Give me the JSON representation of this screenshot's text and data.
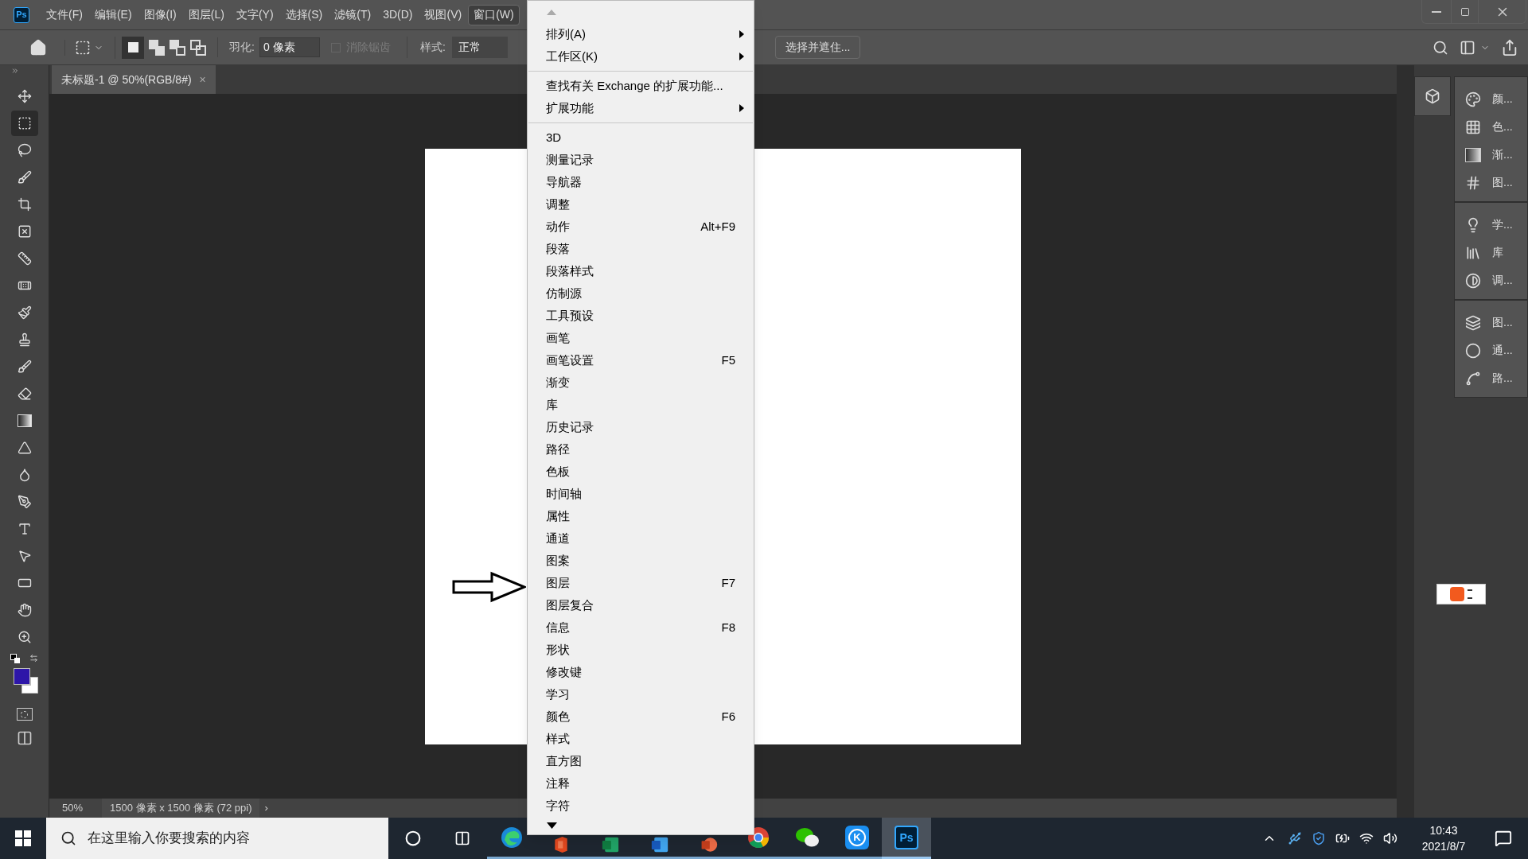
{
  "app": {
    "logo": "Ps"
  },
  "menubar": [
    {
      "label": "文件(F)",
      "selected": false
    },
    {
      "label": "编辑(E)",
      "selected": false
    },
    {
      "label": "图像(I)",
      "selected": false
    },
    {
      "label": "图层(L)",
      "selected": false
    },
    {
      "label": "文字(Y)",
      "selected": false
    },
    {
      "label": "选择(S)",
      "selected": false
    },
    {
      "label": "滤镜(T)",
      "selected": false
    },
    {
      "label": "3D(D)",
      "selected": false
    },
    {
      "label": "视图(V)",
      "selected": false
    },
    {
      "label": "窗口(W)",
      "selected": true
    }
  ],
  "options_bar": {
    "feather_label": "羽化:",
    "feather_value": "0 像素",
    "anti_alias": {
      "label": "消除锯齿",
      "checked": false,
      "disabled": true
    },
    "style_label": "样式:",
    "style_value": "正常",
    "select_mask_button": "选择并遮住..."
  },
  "document_tab": {
    "title": "未标题-1 @ 50%(RGB/8#)",
    "close": "×"
  },
  "tools": [
    {
      "kind": "move",
      "selected": false
    },
    {
      "kind": "marquee",
      "selected": true
    },
    {
      "kind": "lasso",
      "selected": false
    },
    {
      "kind": "quick-select",
      "selected": false
    },
    {
      "kind": "crop",
      "selected": false
    },
    {
      "kind": "frame",
      "selected": false
    },
    {
      "kind": "ruler",
      "selected": false
    },
    {
      "kind": "healing",
      "selected": false
    },
    {
      "kind": "brush",
      "selected": false
    },
    {
      "kind": "stamp",
      "selected": false
    },
    {
      "kind": "history-brush",
      "selected": false
    },
    {
      "kind": "eraser",
      "selected": false
    },
    {
      "kind": "gradient",
      "selected": false
    },
    {
      "kind": "blur",
      "selected": false
    },
    {
      "kind": "dodge",
      "selected": false
    },
    {
      "kind": "pen",
      "selected": false
    },
    {
      "kind": "type",
      "selected": false
    },
    {
      "kind": "path-select",
      "selected": false
    },
    {
      "kind": "rectangle",
      "selected": false
    },
    {
      "kind": "hand",
      "selected": false
    },
    {
      "kind": "zoom",
      "selected": false
    }
  ],
  "swatches": [
    {
      "kind": "foreground",
      "color": "#2d16a8"
    },
    {
      "kind": "background",
      "color": "#ffffff"
    }
  ],
  "status_bar": {
    "zoom": "50%",
    "doc_size": "1500 像素 x 1500 像素 (72 ppi)",
    "more": "›"
  },
  "window_menu": [
    {
      "kind": "item",
      "label": "排列(A)",
      "submenu": true
    },
    {
      "kind": "item",
      "label": "工作区(K)",
      "submenu": true
    },
    {
      "kind": "separator"
    },
    {
      "kind": "item",
      "label": "查找有关 Exchange 的扩展功能...",
      "submenu": false
    },
    {
      "kind": "item",
      "label": "扩展功能",
      "submenu": true
    },
    {
      "kind": "separator"
    },
    {
      "kind": "item",
      "label": "3D",
      "submenu": false
    },
    {
      "kind": "item",
      "label": "测量记录",
      "submenu": false
    },
    {
      "kind": "item",
      "label": "导航器",
      "submenu": false
    },
    {
      "kind": "item",
      "label": "调整",
      "submenu": false
    },
    {
      "kind": "item",
      "label": "动作",
      "shortcut": "Alt+F9",
      "submenu": false
    },
    {
      "kind": "item",
      "label": "段落",
      "submenu": false
    },
    {
      "kind": "item",
      "label": "段落样式",
      "submenu": false
    },
    {
      "kind": "item",
      "label": "仿制源",
      "submenu": false
    },
    {
      "kind": "item",
      "label": "工具预设",
      "submenu": false
    },
    {
      "kind": "item",
      "label": "画笔",
      "submenu": false
    },
    {
      "kind": "item",
      "label": "画笔设置",
      "shortcut": "F5",
      "submenu": false
    },
    {
      "kind": "item",
      "label": "渐变",
      "submenu": false
    },
    {
      "kind": "item",
      "label": "库",
      "submenu": false
    },
    {
      "kind": "item",
      "label": "历史记录",
      "submenu": false
    },
    {
      "kind": "item",
      "label": "路径",
      "submenu": false
    },
    {
      "kind": "item",
      "label": "色板",
      "submenu": false
    },
    {
      "kind": "item",
      "label": "时间轴",
      "submenu": false
    },
    {
      "kind": "item",
      "label": "属性",
      "submenu": false
    },
    {
      "kind": "item",
      "label": "通道",
      "submenu": false
    },
    {
      "kind": "item",
      "label": "图案",
      "submenu": false
    },
    {
      "kind": "item",
      "label": "图层",
      "shortcut": "F7",
      "submenu": false
    },
    {
      "kind": "item",
      "label": "图层复合",
      "submenu": false
    },
    {
      "kind": "item",
      "label": "信息",
      "shortcut": "F8",
      "submenu": false
    },
    {
      "kind": "item",
      "label": "形状",
      "submenu": false
    },
    {
      "kind": "item",
      "label": "修改键",
      "submenu": false
    },
    {
      "kind": "item",
      "label": "学习",
      "submenu": false
    },
    {
      "kind": "item",
      "label": "颜色",
      "shortcut": "F6",
      "submenu": false
    },
    {
      "kind": "item",
      "label": "样式",
      "submenu": false
    },
    {
      "kind": "item",
      "label": "直方图",
      "submenu": false
    },
    {
      "kind": "item",
      "label": "注释",
      "submenu": false
    },
    {
      "kind": "item",
      "label": "字符",
      "submenu": false
    }
  ],
  "panel_groups": [
    [
      {
        "kind": "color",
        "label": "颜..."
      },
      {
        "kind": "swatches",
        "label": "色..."
      },
      {
        "kind": "gradients",
        "label": "渐..."
      },
      {
        "kind": "patterns",
        "label": "图..."
      }
    ],
    [
      {
        "kind": "learn",
        "label": "学..."
      },
      {
        "kind": "libraries",
        "label": "库"
      },
      {
        "kind": "adjustments",
        "label": "调..."
      }
    ],
    [
      {
        "kind": "layers",
        "label": "图..."
      },
      {
        "kind": "channels",
        "label": "通..."
      },
      {
        "kind": "paths",
        "label": "路..."
      }
    ]
  ],
  "taskbar": {
    "search_placeholder": "在这里输入你要搜索的内容",
    "apps": [
      {
        "kind": "edge",
        "selected": false
      },
      {
        "kind": "office",
        "selected": false
      },
      {
        "kind": "excel",
        "selected": false
      },
      {
        "kind": "word",
        "selected": false
      },
      {
        "kind": "powerpoint",
        "selected": false
      },
      {
        "kind": "chrome",
        "selected": false
      },
      {
        "kind": "wechat",
        "selected": false
      },
      {
        "kind": "kugou",
        "label": "K",
        "selected": false
      },
      {
        "kind": "photoshop",
        "label": "Ps",
        "selected": true
      }
    ],
    "time": "10:43",
    "date": "2021/8/7"
  }
}
